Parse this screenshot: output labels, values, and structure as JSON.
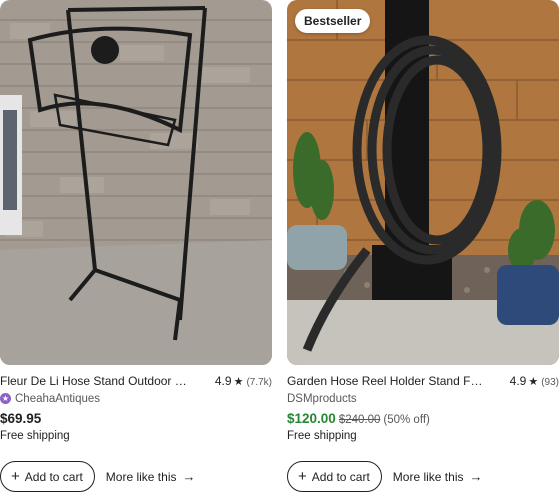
{
  "products": [
    {
      "title": "Fleur De Li Hose Stand Outdoor Garden Water Hose Holder",
      "rating": "4.9",
      "review_count": "(7.7k)",
      "shop": "CheahaAntiques",
      "shop_icon": "star-seller-icon",
      "price": "$69.95",
      "shipping": "Free shipping",
      "add_to_cart": "Add to cart",
      "more_like_this": "More like this"
    },
    {
      "badge": "Bestseller",
      "title": "Garden Hose Reel Holder Stand Freestanding",
      "rating": "4.9",
      "review_count": "(93)",
      "shop": "DSMproducts",
      "price": "$120.00",
      "original_price": "$240.00",
      "discount": "(50% off)",
      "shipping": "Free shipping",
      "add_to_cart": "Add to cart",
      "more_like_this": "More like this"
    }
  ],
  "colors": {
    "sale_price": "#258635",
    "shop_icon": "#8a63c7",
    "text": "#222222",
    "muted": "#595959"
  }
}
